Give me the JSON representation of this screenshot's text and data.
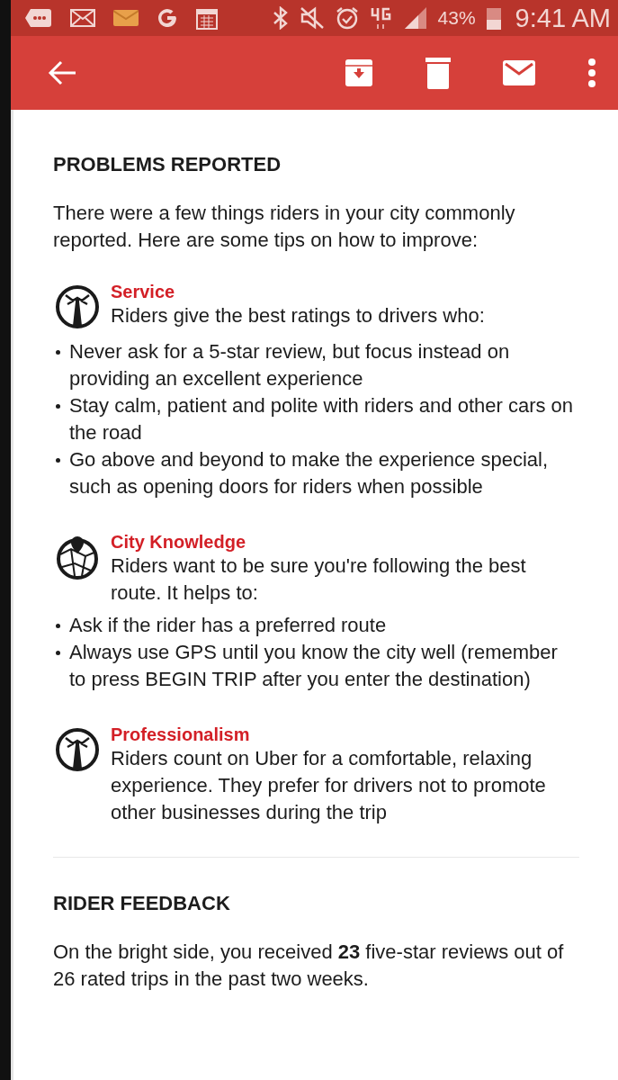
{
  "status_bar": {
    "battery": "43%",
    "time": "9:41 AM"
  },
  "problems": {
    "title": "PROBLEMS REPORTED",
    "intro": "There were a few things riders in your city commonly reported. Here are some tips on how to improve:",
    "tips": [
      {
        "kind": "tie",
        "title": "Service",
        "description": "Riders give the best ratings to drivers who:",
        "bullets": [
          "Never ask for a 5-star review, but focus instead on providing an excellent experience",
          "Stay calm, patient and polite with riders and other cars on the road",
          "Go above and beyond to make the experience special, such as opening doors for riders when possible"
        ]
      },
      {
        "kind": "map",
        "title": "City Knowledge",
        "description": "Riders want to be sure you're following the best route. It helps to:",
        "bullets": [
          "Ask if the rider has a preferred route",
          "Always use GPS until you know the city well (remember to press BEGIN TRIP after you enter the destination)"
        ]
      },
      {
        "kind": "tie",
        "title": "Professionalism",
        "description": "Riders count on Uber for a comfortable, relaxing experience. They prefer for drivers not to promote other businesses during the trip"
      }
    ]
  },
  "feedback": {
    "title": "RIDER FEEDBACK",
    "text": "On the bright side, you received **23** five-star reviews out of 26 rated trips in the past two weeks."
  }
}
